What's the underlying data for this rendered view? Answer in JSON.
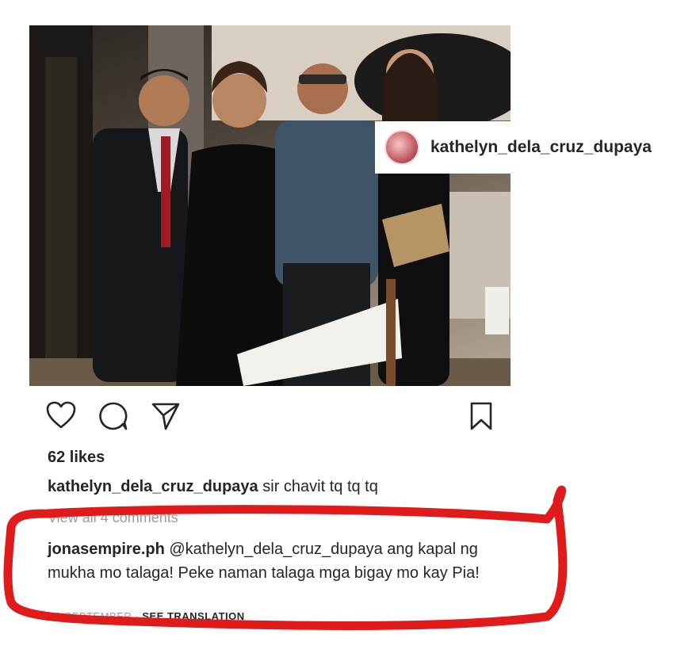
{
  "post": {
    "tagged_username": "kathelyn_dela_cruz_dupaya",
    "likes": "62 likes",
    "caption_user": "kathelyn_dela_cruz_dupaya",
    "caption_text": " sir chavit tq tq tq",
    "view_all_comments": "View all 4 comments",
    "comment_user": "jonasempire.ph",
    "comment_text": " @kathelyn_dela_cruz_dupaya ang kapal ng mukha mo talaga! Peke naman talaga mga bigay mo kay Pia!",
    "date": "19 SEPTEMBER",
    "separator": " · ",
    "see_translation": "SEE TRANSLATION"
  },
  "icons": [
    "heart-icon",
    "comment-icon",
    "share-icon",
    "bookmark-icon"
  ],
  "colors": {
    "annotation_red": "#e01b1b",
    "text": "#262626",
    "muted": "#9a9a9a"
  }
}
